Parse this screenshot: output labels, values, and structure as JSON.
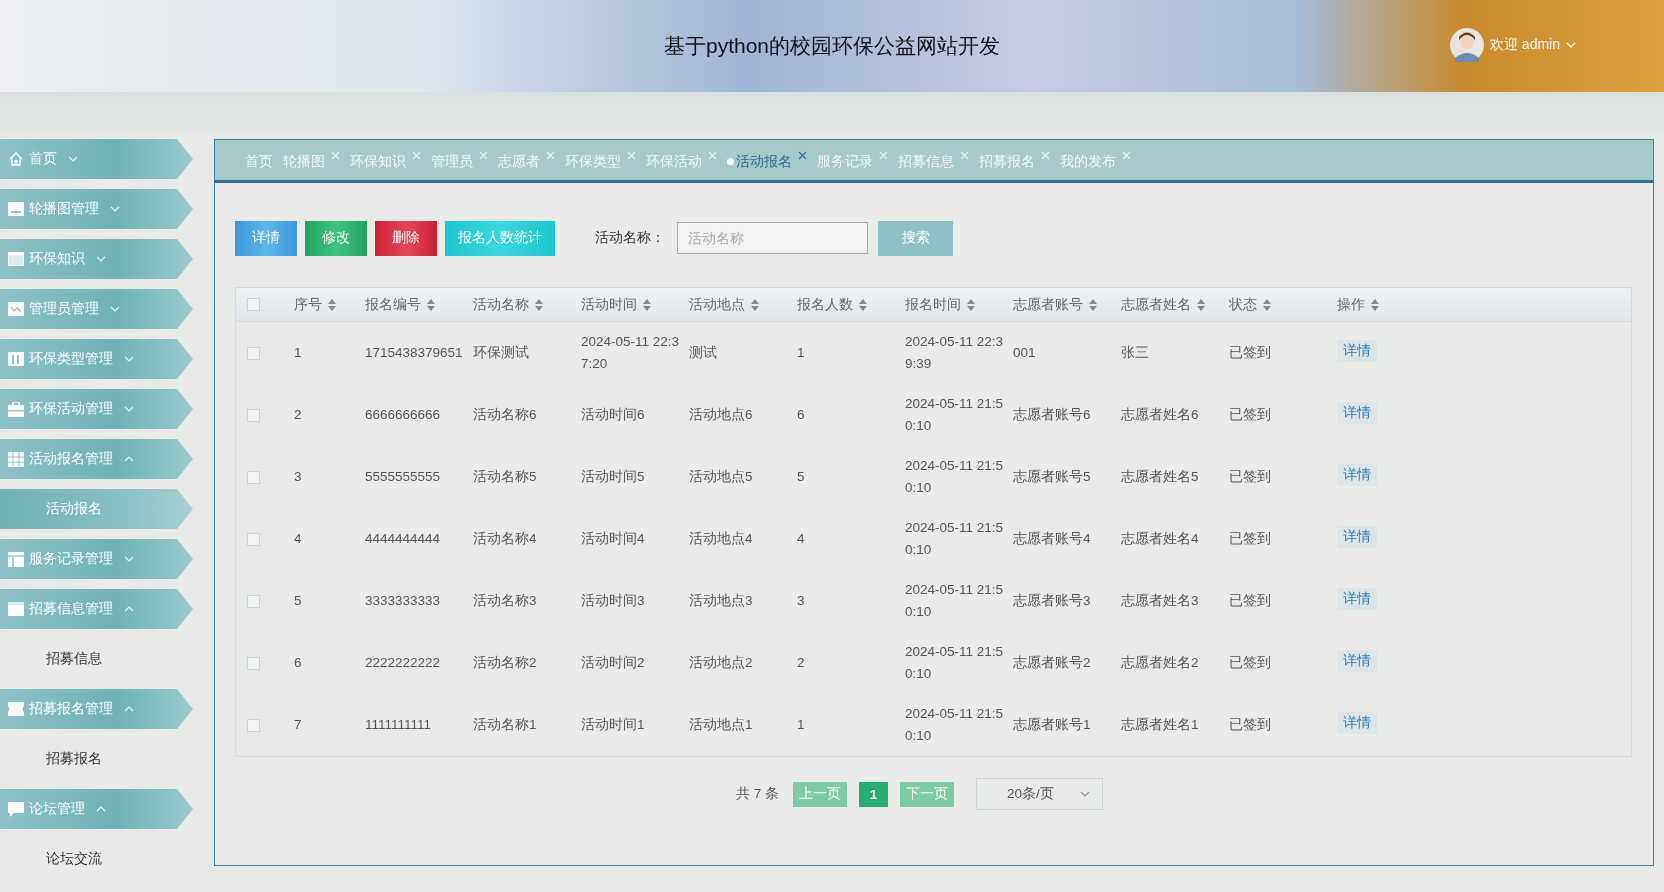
{
  "header": {
    "title": "基于python的校园环保公益网站开发",
    "user": "欢迎 admin"
  },
  "sidebar": {
    "items": [
      {
        "label": "首页",
        "kind": "menu",
        "expanded": false
      },
      {
        "label": "轮播图管理",
        "kind": "menu",
        "expanded": false
      },
      {
        "label": "环保知识",
        "kind": "menu",
        "expanded": false
      },
      {
        "label": "管理员管理",
        "kind": "menu",
        "expanded": false
      },
      {
        "label": "环保类型管理",
        "kind": "menu",
        "expanded": false
      },
      {
        "label": "环保活动管理",
        "kind": "menu",
        "expanded": false
      },
      {
        "label": "活动报名管理",
        "kind": "menu",
        "expanded": true
      },
      {
        "label": "活动报名",
        "kind": "sub",
        "selected": true
      },
      {
        "label": "服务记录管理",
        "kind": "menu",
        "expanded": false
      },
      {
        "label": "招募信息管理",
        "kind": "menu",
        "expanded": true
      },
      {
        "label": "招募信息",
        "kind": "sub",
        "selected": false
      },
      {
        "label": "招募报名管理",
        "kind": "menu",
        "expanded": true
      },
      {
        "label": "招募报名",
        "kind": "sub",
        "selected": false
      },
      {
        "label": "论坛管理",
        "kind": "menu",
        "expanded": true
      },
      {
        "label": "论坛交流",
        "kind": "sub",
        "selected": false
      }
    ]
  },
  "tabs": [
    {
      "label": "首页",
      "closable": false,
      "selected": false
    },
    {
      "label": "轮播图",
      "closable": true,
      "selected": false
    },
    {
      "label": "环保知识",
      "closable": true,
      "selected": false
    },
    {
      "label": "管理员",
      "closable": true,
      "selected": false
    },
    {
      "label": "志愿者",
      "closable": true,
      "selected": false
    },
    {
      "label": "环保类型",
      "closable": true,
      "selected": false
    },
    {
      "label": "环保活动",
      "closable": true,
      "selected": false
    },
    {
      "label": "活动报名",
      "closable": true,
      "selected": true
    },
    {
      "label": "服务记录",
      "closable": true,
      "selected": false
    },
    {
      "label": "招募信息",
      "closable": true,
      "selected": false
    },
    {
      "label": "招募报名",
      "closable": true,
      "selected": false
    },
    {
      "label": "我的发布",
      "closable": true,
      "selected": false
    }
  ],
  "toolbar": {
    "buttons": [
      {
        "label": "详情",
        "kind": "info"
      },
      {
        "label": "修改",
        "kind": "edit"
      },
      {
        "label": "删除",
        "kind": "delete"
      },
      {
        "label": "报名人数统计",
        "kind": "stats"
      }
    ],
    "search": {
      "label": "活动名称：",
      "placeholder": "活动名称",
      "button": "搜索"
    }
  },
  "table": {
    "select_all": false,
    "columns": [
      "序号",
      "报名编号",
      "活动名称",
      "活动时间",
      "活动地点",
      "报名人数",
      "报名时间",
      "志愿者账号",
      "志愿者姓名",
      "状态",
      "操作"
    ],
    "rows": [
      {
        "checked": false,
        "cells": [
          "1",
          "1715438379651",
          "环保测试",
          "2024-05-11 22:37:20",
          "测试",
          "1",
          "2024-05-11 22:39:39",
          "001",
          "张三",
          "已签到"
        ],
        "action": "详情"
      },
      {
        "checked": false,
        "cells": [
          "2",
          "6666666666",
          "活动名称6",
          "活动时间6",
          "活动地点6",
          "6",
          "2024-05-11 21:50:10",
          "志愿者账号6",
          "志愿者姓名6",
          "已签到"
        ],
        "action": "详情"
      },
      {
        "checked": false,
        "cells": [
          "3",
          "5555555555",
          "活动名称5",
          "活动时间5",
          "活动地点5",
          "5",
          "2024-05-11 21:50:10",
          "志愿者账号5",
          "志愿者姓名5",
          "已签到"
        ],
        "action": "详情"
      },
      {
        "checked": false,
        "cells": [
          "4",
          "4444444444",
          "活动名称4",
          "活动时间4",
          "活动地点4",
          "4",
          "2024-05-11 21:50:10",
          "志愿者账号4",
          "志愿者姓名4",
          "已签到"
        ],
        "action": "详情"
      },
      {
        "checked": false,
        "cells": [
          "5",
          "3333333333",
          "活动名称3",
          "活动时间3",
          "活动地点3",
          "3",
          "2024-05-11 21:50:10",
          "志愿者账号3",
          "志愿者姓名3",
          "已签到"
        ],
        "action": "详情"
      },
      {
        "checked": false,
        "cells": [
          "6",
          "2222222222",
          "活动名称2",
          "活动时间2",
          "活动地点2",
          "2",
          "2024-05-11 21:50:10",
          "志愿者账号2",
          "志愿者姓名2",
          "已签到"
        ],
        "action": "详情"
      },
      {
        "checked": false,
        "cells": [
          "7",
          "1111111111",
          "活动名称1",
          "活动时间1",
          "活动地点1",
          "1",
          "2024-05-11 21:50:10",
          "志愿者账号1",
          "志愿者姓名1",
          "已签到"
        ],
        "action": "详情"
      }
    ]
  },
  "pager": {
    "total": "共 7 条",
    "prev": "上一页",
    "pages": [
      {
        "label": "1",
        "selected": true
      }
    ],
    "next": "下一页",
    "page_size": "20条/页"
  }
}
